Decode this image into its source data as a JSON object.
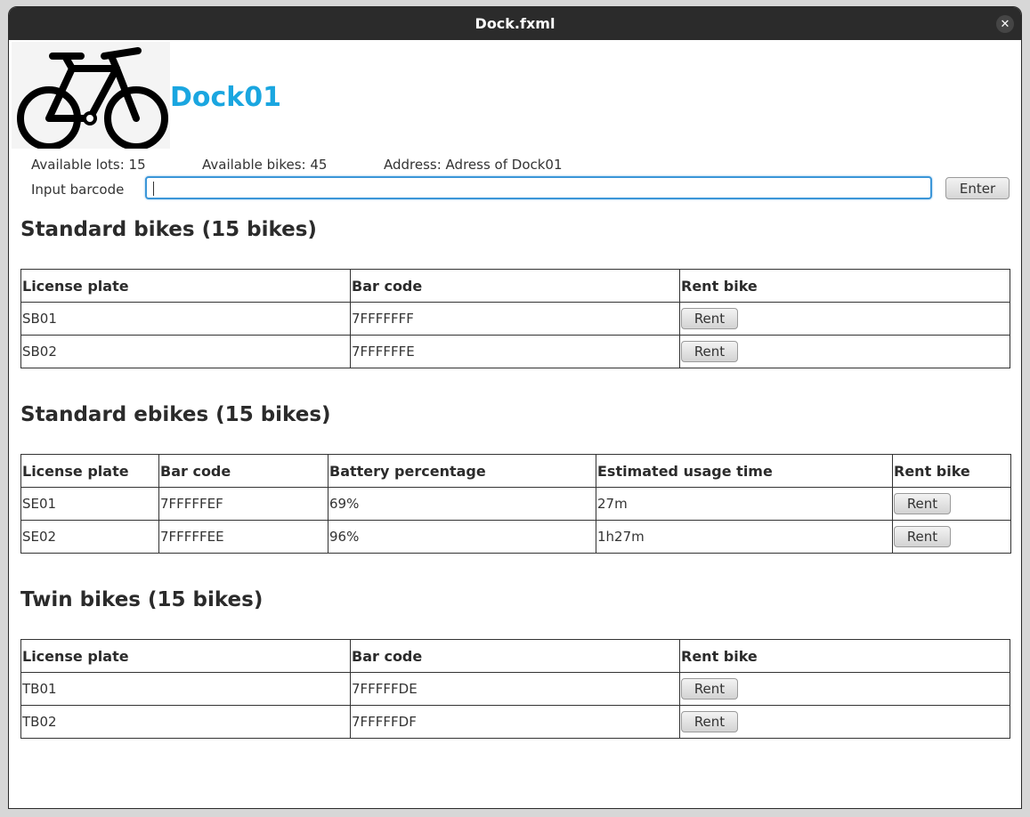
{
  "window": {
    "title": "Dock.fxml",
    "close_glyph": "✕"
  },
  "dock": {
    "name": "Dock01",
    "available_lots": "Available lots: 15",
    "available_bikes": "Available bikes: 45",
    "address": "Address: Adress of Dock01",
    "barcode_label": "Input barcode",
    "barcode_value": "",
    "enter_label": "Enter",
    "logo_icon": "bicycle-icon",
    "accent_color": "#1aa6e0"
  },
  "standard_bikes": {
    "title": "Standard bikes (15 bikes)",
    "headers": [
      "License plate",
      "Bar code",
      "Rent bike"
    ],
    "rows": [
      {
        "plate": "SB01",
        "barcode": "7FFFFFFF",
        "rent": "Rent"
      },
      {
        "plate": "SB02",
        "barcode": "7FFFFFFE",
        "rent": "Rent"
      }
    ]
  },
  "standard_ebikes": {
    "title": "Standard ebikes (15 bikes)",
    "headers": [
      "License plate",
      "Bar code",
      "Battery percentage",
      "Estimated usage time",
      "Rent bike"
    ],
    "rows": [
      {
        "plate": "SE01",
        "barcode": "7FFFFFEF",
        "battery": "69%",
        "usage": "27m",
        "rent": "Rent"
      },
      {
        "plate": "SE02",
        "barcode": "7FFFFFEE",
        "battery": "96%",
        "usage": "1h27m",
        "rent": "Rent"
      }
    ]
  },
  "twin_bikes": {
    "title": "Twin bikes (15 bikes)",
    "headers": [
      "License plate",
      "Bar code",
      "Rent bike"
    ],
    "rows": [
      {
        "plate": "TB01",
        "barcode": "7FFFFFDE",
        "rent": "Rent"
      },
      {
        "plate": "TB02",
        "barcode": "7FFFFFDF",
        "rent": "Rent"
      }
    ]
  }
}
